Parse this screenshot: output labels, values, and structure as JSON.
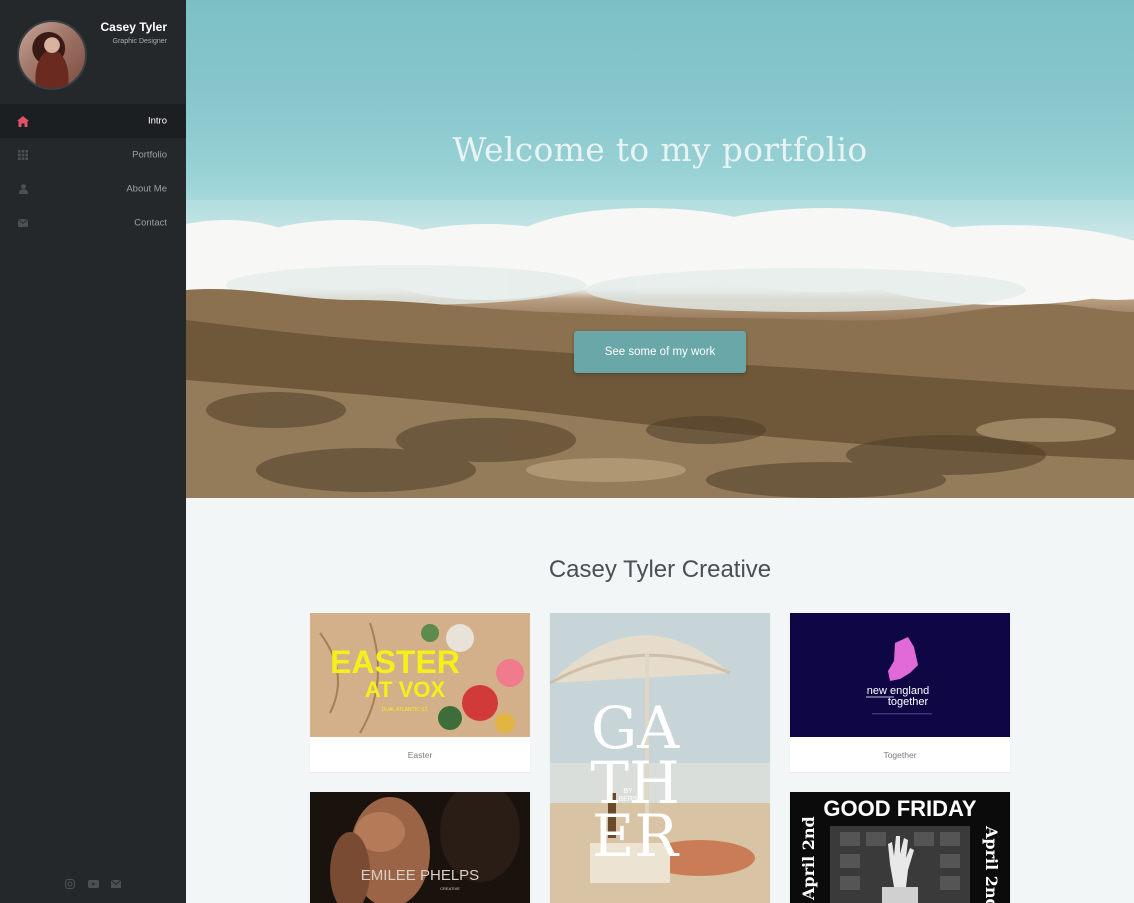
{
  "sidebar": {
    "profile": {
      "name": "Casey Tyler",
      "role": "Graphic Designer"
    },
    "nav": [
      {
        "label": "Intro",
        "icon": "home-icon",
        "active": true
      },
      {
        "label": "Portfolio",
        "icon": "grid-icon",
        "active": false
      },
      {
        "label": "About Me",
        "icon": "user-icon",
        "active": false
      },
      {
        "label": "Contact",
        "icon": "envelope-icon",
        "active": false
      }
    ],
    "social": [
      "instagram-icon",
      "youtube-icon",
      "envelope-icon"
    ]
  },
  "hero": {
    "title": "Welcome to my portfolio",
    "button_label": "See some of my work"
  },
  "portfolio": {
    "title": "Casey Tyler Creative",
    "items": [
      {
        "caption": "Easter",
        "art_lines": [
          "EASTER",
          "AT VOX",
          "DUAL ATLANTIC ST."
        ]
      },
      {
        "caption": "",
        "art_lines": [
          "GA",
          "TH",
          "ER",
          "BY",
          "BERS"
        ]
      },
      {
        "caption": "Together",
        "art_lines": [
          "new england",
          "together"
        ]
      },
      {
        "caption": "",
        "art_lines": [
          "EMILEE PHELPS",
          "CREATIVE"
        ]
      },
      {
        "caption": "",
        "art_lines": [
          "GOOD FRIDAY",
          "April 2nd",
          "April 2nd"
        ]
      }
    ]
  },
  "colors": {
    "sidebar_bg": "#24282b",
    "accent_home": "#e0526a",
    "button_bg": "#6aa7a8"
  }
}
